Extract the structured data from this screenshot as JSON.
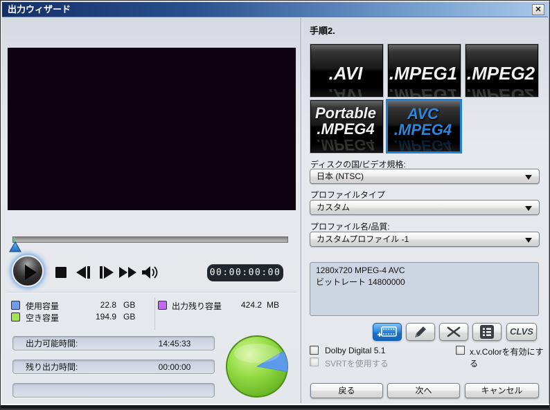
{
  "window": {
    "title": "出力ウィザード",
    "close_glyph": "✕"
  },
  "colors": {
    "accent_blue": "#1e82d8",
    "used_swatch": "#6f9bef",
    "free_swatch": "#a3e54d",
    "remain_swatch": "#c168ee",
    "pie_used": "#5b9bea",
    "pie_free": "#7ccc33"
  },
  "left": {
    "timecode": "00:00:00:00",
    "capacity": {
      "used_label": "使用容量",
      "used_value": "22.8",
      "used_unit": "GB",
      "free_label": "空き容量",
      "free_value": "194.9",
      "free_unit": "GB",
      "remain_label": "出力残り容量",
      "remain_value": "424.2",
      "remain_unit": "MB"
    },
    "times": {
      "writable_label": "出力可能時間:",
      "writable_value": "14:45:33",
      "remaining_label": "残り出力時間:",
      "remaining_value": "00:00:00"
    }
  },
  "chart_data": {
    "type": "pie",
    "categories": [
      "使用容量",
      "空き容量"
    ],
    "values": [
      22.8,
      194.9
    ],
    "unit": "GB",
    "colors": [
      "#5b9bea",
      "#7ccc33"
    ]
  },
  "right": {
    "step": "手順2.",
    "formats": [
      {
        "line1": ".AVI"
      },
      {
        "line1": ".MPEG1"
      },
      {
        "line1": ".MPEG2"
      },
      {
        "line1": "Portable",
        "line2": ".MPEG4"
      },
      {
        "line1": "AVC",
        "line2": ".MPEG4",
        "selected": true
      }
    ],
    "selects": [
      {
        "label": "ディスクの国/ビデオ規格:",
        "value": "日本 (NTSC)"
      },
      {
        "label": "プロファイルタイプ",
        "value": "カスタム"
      },
      {
        "label": "プロファイル名/品質:",
        "value": "カスタムプロファイル -1"
      }
    ],
    "profile_info": [
      "1280x720 MPEG-4 AVC",
      "ビットレート 14800000"
    ],
    "clvs_label": "CLVS",
    "checkboxes": {
      "dolby": "Dolby Digital 5.1",
      "svrt": "SVRTを使用する",
      "xvcolor": "x.v.Colorを有効にする"
    },
    "nav": {
      "back": "戻る",
      "next": "次へ",
      "cancel": "キャンセル"
    }
  }
}
